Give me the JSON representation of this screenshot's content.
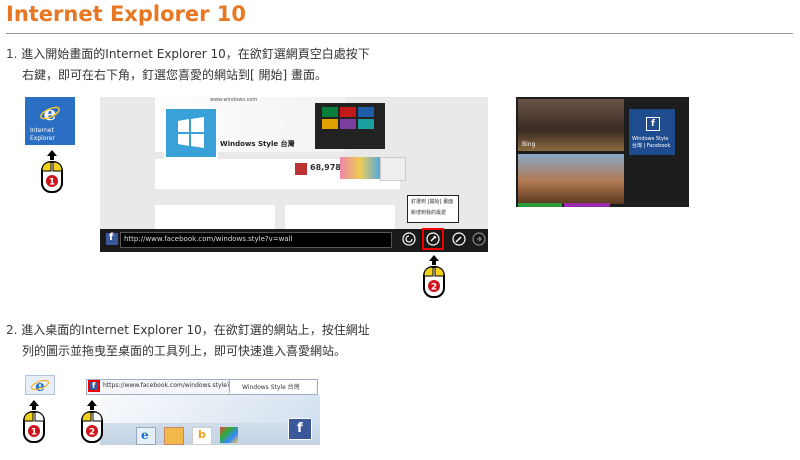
{
  "title": "Internet Explorer 10",
  "step1": {
    "number": "1.",
    "line1": "進入開始畫面的Internet Explorer 10，在欲釘選網頁空白處按下",
    "line2": "右鍵，即可在右下角，釘選您喜愛的網站到[ 開始] 畫面。"
  },
  "step2": {
    "number": "2.",
    "line1": "進入桌面的Internet Explorer 10，在欲釘選的網站上，按住網址",
    "line2": "列的圖示並拖曳至桌面的工具列上，即可快速進入喜愛網站。"
  },
  "ie_tile": {
    "label1": "Internet",
    "label2": "Explorer"
  },
  "browser": {
    "fb_page_title": "Windows Style 台灣",
    "likes": "68,978",
    "url": "http://www.facebook.com/windows.style?v=wall",
    "menu_item1": "釘選到 [開始] 畫面",
    "menu_item2": "新增到我的最愛",
    "site_header": "www.windows.com"
  },
  "tiles": {
    "bing": "Bing",
    "fb_tile1": "Windows Style",
    "fb_tile2": "台灣 | Facebook"
  },
  "desktop": {
    "addr_url": "https://www.facebook.com/windows.style?v=w",
    "tab_title": "Windows Style 台灣"
  },
  "badges": {
    "one": "1",
    "two": "2"
  },
  "colors": {
    "title": "#e87722",
    "badge": "#d0121b",
    "mouse_button": "#f2d11b"
  }
}
